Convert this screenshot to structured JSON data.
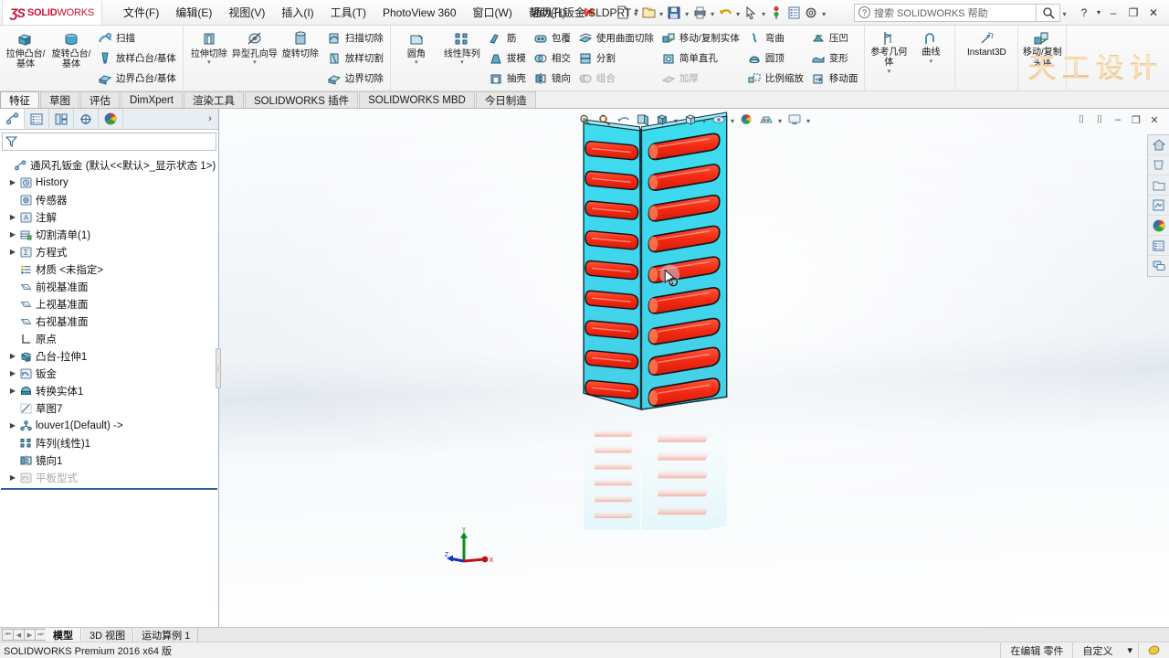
{
  "titlebar": {
    "logo": {
      "ds": "ƷS",
      "bold": "SOLID",
      "thin": "WORKS"
    },
    "menu": [
      {
        "label": "文件(F)"
      },
      {
        "label": "编辑(E)"
      },
      {
        "label": "视图(V)"
      },
      {
        "label": "插入(I)"
      },
      {
        "label": "工具(T)"
      },
      {
        "label": "PhotoView 360"
      },
      {
        "label": "窗口(W)"
      },
      {
        "label": "帮助(H)"
      }
    ],
    "pin_icon": "pin-icon",
    "quick_access": [
      {
        "name": "new-document",
        "caret": true
      },
      {
        "name": "open-document",
        "caret": true
      },
      {
        "name": "save-document",
        "caret": true
      },
      {
        "name": "print-document",
        "caret": true
      },
      {
        "name": "undo",
        "caret": true
      },
      {
        "name": "select",
        "caret": true
      },
      {
        "name": "rebuild",
        "caret": false
      },
      {
        "name": "options-sheet",
        "caret": false
      },
      {
        "name": "settings-gear",
        "caret": true
      }
    ],
    "document_title": "通风孔钣金.SLDPRT *",
    "search": {
      "placeholder": "搜索 SOLIDWORKS 帮助",
      "value": ""
    },
    "help_label": "?",
    "window_controls": {
      "minimize": "–",
      "restore": "❐",
      "close": "✕"
    }
  },
  "ribbon": {
    "watermark": "天工设计",
    "groups": [
      {
        "big": [
          {
            "label": "拉伸凸台/基体",
            "icon": "extrude-boss-icon",
            "dropdown": false
          },
          {
            "label": "旋转凸台/基体",
            "icon": "revolve-boss-icon",
            "dropdown": false
          }
        ],
        "small": [
          {
            "label": "扫描",
            "icon": "sweep-icon",
            "dim": false
          },
          {
            "label": "放样凸台/基体",
            "icon": "loft-icon",
            "dim": false
          },
          {
            "label": "边界凸台/基体",
            "icon": "boundary-icon",
            "dim": false
          }
        ]
      },
      {
        "big": [
          {
            "label": "拉伸切除",
            "icon": "extrude-cut-icon",
            "dropdown": true
          },
          {
            "label": "异型孔向导",
            "icon": "hole-wizard-icon",
            "dropdown": false
          },
          {
            "label": "旋转切除",
            "icon": "revolve-cut-icon",
            "dropdown": false
          }
        ],
        "small": [
          {
            "label": "扫描切除",
            "icon": "sweep-cut-icon",
            "dim": false
          },
          {
            "label": "放样切割",
            "icon": "loft-cut-icon",
            "dim": false
          },
          {
            "label": "边界切除",
            "icon": "boundary-cut-icon",
            "dim": false
          }
        ]
      },
      {
        "big": [
          {
            "label": "圆角",
            "icon": "fillet-icon",
            "dropdown": true
          },
          {
            "label": "线性阵列",
            "icon": "linear-pattern-icon",
            "dropdown": true
          }
        ],
        "small": [
          {
            "label": "筋",
            "icon": "rib-icon",
            "dim": false
          },
          {
            "label": "拔模",
            "icon": "draft-icon",
            "dim": false
          },
          {
            "label": "抽壳",
            "icon": "shell-icon",
            "dim": false
          }
        ],
        "small2": [
          {
            "label": "包覆",
            "icon": "wrap-icon",
            "dim": false
          },
          {
            "label": "相交",
            "icon": "intersect-icon",
            "dim": false
          },
          {
            "label": "镜向",
            "icon": "mirror-icon",
            "dim": false
          }
        ],
        "small3": [
          {
            "label": "使用曲面切除",
            "icon": "cut-with-surface-icon",
            "dim": false
          },
          {
            "label": "分割",
            "icon": "split-icon",
            "dim": false
          },
          {
            "label": "组合",
            "icon": "combine-icon",
            "dim": true
          }
        ],
        "small4": [
          {
            "label": "移动/复制实体",
            "icon": "move-copy-body-icon",
            "dim": false
          },
          {
            "label": "简单直孔",
            "icon": "simple-hole-icon",
            "dim": false
          },
          {
            "label": "加厚",
            "icon": "thicken-icon",
            "dim": true
          }
        ],
        "small5": [
          {
            "label": "弯曲",
            "icon": "flex-icon",
            "dim": false
          },
          {
            "label": "圆顶",
            "icon": "dome-icon",
            "dim": false
          },
          {
            "label": "比例缩放",
            "icon": "scale-icon",
            "dim": false
          }
        ],
        "small6": [
          {
            "label": "压凹",
            "icon": "indent-icon",
            "dim": false
          },
          {
            "label": "变形",
            "icon": "deform-icon",
            "dim": false
          },
          {
            "label": "移动面",
            "icon": "move-face-icon",
            "dim": false
          }
        ]
      },
      {
        "mid": [
          {
            "label": "参考几何体",
            "icon": "reference-geometry-icon",
            "dropdown": true
          },
          {
            "label": "曲线",
            "icon": "curves-icon",
            "dropdown": true
          }
        ]
      },
      {
        "mid2": [
          {
            "label": "Instant3D",
            "icon": "instant3d-icon",
            "dropdown": false
          }
        ]
      },
      {
        "mid3": [
          {
            "label": "移动/复制实体",
            "icon": "move-copy-icon",
            "dropdown": false
          }
        ]
      }
    ]
  },
  "command_tabs": [
    {
      "label": "特征",
      "active": true
    },
    {
      "label": "草图",
      "active": false
    },
    {
      "label": "评估",
      "active": false
    },
    {
      "label": "DimXpert",
      "active": false
    },
    {
      "label": "渲染工具",
      "active": false
    },
    {
      "label": "SOLIDWORKS 插件",
      "active": false
    },
    {
      "label": "SOLIDWORKS MBD",
      "active": false
    },
    {
      "label": "今日制造",
      "active": false
    }
  ],
  "feature_manager": {
    "tabs": [
      {
        "name": "feature-manager-tab",
        "icon": "feature-tree-icon",
        "active": true
      },
      {
        "name": "property-manager-tab",
        "icon": "property-list-icon",
        "active": false
      },
      {
        "name": "configuration-manager-tab",
        "icon": "configuration-icon",
        "active": false
      },
      {
        "name": "dimxpert-manager-tab",
        "icon": "dimxpert-icon",
        "active": false
      },
      {
        "name": "display-manager-tab",
        "icon": "display-palette-icon",
        "active": false
      }
    ],
    "expand_arrow": "›",
    "filter": {
      "placeholder": "",
      "value": "",
      "icon": "filter-icon"
    },
    "root": {
      "label": "通风孔钣金  (默认<<默认>_显示状态 1>)",
      "icon": "part-icon"
    },
    "items": [
      {
        "label": "History",
        "icon": "history-icon",
        "expandable": true,
        "indent": 1,
        "dim": false
      },
      {
        "label": "传感器",
        "icon": "sensor-icon",
        "expandable": false,
        "indent": 1,
        "dim": false
      },
      {
        "label": "注解",
        "icon": "annotation-icon",
        "expandable": true,
        "indent": 1,
        "dim": false
      },
      {
        "label": "切割清单(1)",
        "icon": "cutlist-icon",
        "expandable": true,
        "indent": 1,
        "dim": false
      },
      {
        "label": "方程式",
        "icon": "equation-icon",
        "expandable": true,
        "indent": 1,
        "dim": false
      },
      {
        "label": "材质 <未指定>",
        "icon": "material-icon",
        "expandable": false,
        "indent": 1,
        "dim": false
      },
      {
        "label": "前视基准面",
        "icon": "plane-icon",
        "expandable": false,
        "indent": 1,
        "dim": false
      },
      {
        "label": "上视基准面",
        "icon": "plane-icon",
        "expandable": false,
        "indent": 1,
        "dim": false
      },
      {
        "label": "右视基准面",
        "icon": "plane-icon",
        "expandable": false,
        "indent": 1,
        "dim": false
      },
      {
        "label": "原点",
        "icon": "origin-icon",
        "expandable": false,
        "indent": 1,
        "dim": false
      },
      {
        "label": "凸台-拉伸1",
        "icon": "boss-extrude-icon",
        "expandable": true,
        "indent": 1,
        "dim": false
      },
      {
        "label": "钣金",
        "icon": "sheetmetal-icon",
        "expandable": true,
        "indent": 1,
        "dim": false
      },
      {
        "label": "转换实体1",
        "icon": "convert-solid-icon",
        "expandable": true,
        "indent": 1,
        "dim": false
      },
      {
        "label": "草图7",
        "icon": "sketch-icon",
        "expandable": false,
        "indent": 1,
        "dim": false
      },
      {
        "label": "louver1(Default) ->",
        "icon": "louver-icon",
        "expandable": true,
        "indent": 1,
        "dim": false
      },
      {
        "label": "阵列(线性)1",
        "icon": "linear-pattern-tree-icon",
        "expandable": false,
        "indent": 1,
        "dim": false
      },
      {
        "label": "镜向1",
        "icon": "mirror-tree-icon",
        "expandable": false,
        "indent": 1,
        "dim": false
      },
      {
        "label": "平板型式",
        "icon": "flat-pattern-icon",
        "expandable": true,
        "indent": 1,
        "dim": true
      }
    ]
  },
  "graphics": {
    "hud_buttons": [
      {
        "name": "zoom-to-fit-icon",
        "caret": false
      },
      {
        "name": "zoom-to-area-icon",
        "caret": false
      },
      {
        "name": "previous-view-icon",
        "caret": false
      },
      {
        "name": "section-view-icon",
        "caret": false
      },
      {
        "name": "view-orientation-icon",
        "caret": true
      },
      {
        "name": "display-style-icon",
        "caret": true
      },
      {
        "name": "hide-show-items-icon",
        "caret": true
      },
      {
        "name": "edit-appearance-icon",
        "caret": false
      },
      {
        "name": "apply-scene-icon",
        "caret": true
      },
      {
        "name": "view-settings-icon",
        "caret": true
      }
    ],
    "view_controls": [
      {
        "name": "restore-panel-left-icon",
        "glyph": "⌷"
      },
      {
        "name": "restore-panel-right-icon",
        "glyph": "⌷"
      },
      {
        "name": "minimize-view-icon",
        "glyph": "–"
      },
      {
        "name": "restore-view-icon",
        "glyph": "❐"
      },
      {
        "name": "close-view-icon",
        "glyph": "✕"
      }
    ],
    "task_pane": [
      {
        "name": "solidworks-resources-icon",
        "glyph": "home"
      },
      {
        "name": "design-library-icon",
        "glyph": "library"
      },
      {
        "name": "file-explorer-icon",
        "glyph": "folder"
      },
      {
        "name": "view-palette-icon",
        "glyph": "palette-view"
      },
      {
        "name": "appearances-scenes-icon",
        "glyph": "appearance"
      },
      {
        "name": "custom-properties-icon",
        "glyph": "properties"
      },
      {
        "name": "solidworks-forum-icon",
        "glyph": "forum"
      }
    ],
    "axes": {
      "x": "X",
      "y": "Y",
      "z": "Z"
    },
    "model": {
      "name": "通风孔钣金",
      "face_color": "#3fd9ee",
      "louver_color": "#f42c18",
      "edge_color": "#102a33",
      "louver_rows": 9,
      "louver_columns": 2
    }
  },
  "sheet_tabs": {
    "nav": [
      "⏮",
      "◀",
      "▶",
      "⏭"
    ],
    "tabs": [
      {
        "label": "模型",
        "active": true
      },
      {
        "label": "3D 视图",
        "active": false
      },
      {
        "label": "运动算例 1",
        "active": false
      }
    ]
  },
  "status_bar": {
    "left": "SOLIDWORKS Premium 2016 x64 版",
    "cells": [
      {
        "label": "在编辑 零件"
      },
      {
        "label": "自定义"
      },
      {
        "label": "▾"
      }
    ],
    "indicator_icon": "overdefine-icon"
  }
}
